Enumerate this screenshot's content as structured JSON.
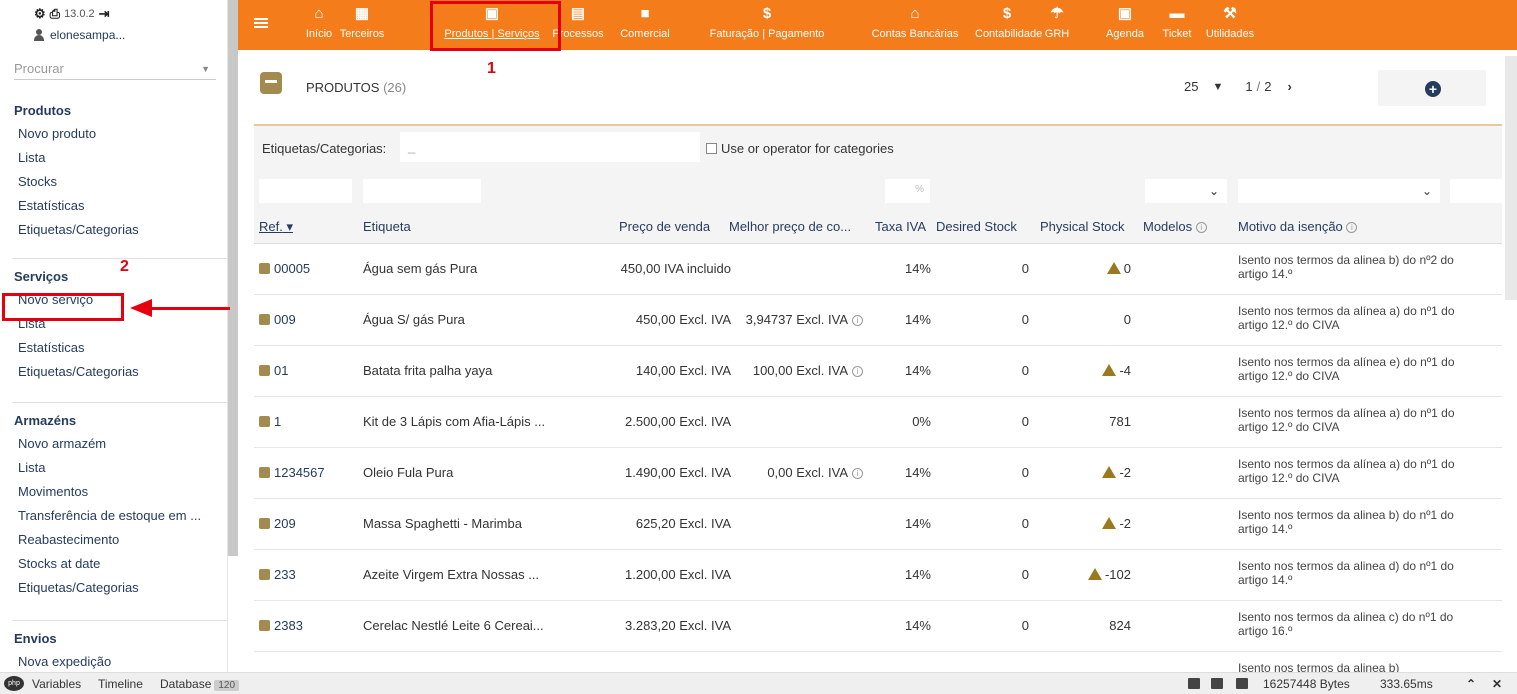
{
  "app": {
    "version": "13.0.2",
    "username": "elonesampa..."
  },
  "sidebar": {
    "search_placeholder": "Procurar",
    "sections": [
      {
        "title": "Produtos",
        "items": [
          "Novo produto",
          "Lista",
          "Stocks",
          "Estatísticas",
          "Etiquetas/Categorias"
        ]
      },
      {
        "title": "Serviços",
        "items": [
          "Novo serviço",
          "Lista",
          "Estatísticas",
          "Etiquetas/Categorias"
        ]
      },
      {
        "title": "Armazéns",
        "items": [
          "Novo armazém",
          "Lista",
          "Movimentos",
          "Transferência de estoque em ...",
          "Reabastecimento",
          "Stocks at date",
          "Etiquetas/Categorias"
        ]
      },
      {
        "title": "Envios",
        "items": [
          "Nova expedição"
        ]
      }
    ]
  },
  "topnav": {
    "items": [
      {
        "label": "Início",
        "icon": "home-icon",
        "glyph": "⌂"
      },
      {
        "label": "Terceiros",
        "icon": "building-icon",
        "glyph": "▦"
      },
      {
        "label": "Produtos | Serviços",
        "icon": "product-icon",
        "glyph": "▣",
        "active": true
      },
      {
        "label": "Processos",
        "icon": "clipboard-icon",
        "glyph": "▤"
      },
      {
        "label": "Comercial",
        "icon": "briefcase-icon",
        "glyph": "■"
      },
      {
        "label": "Faturação | Pagamento",
        "icon": "dollar-icon",
        "glyph": "$"
      },
      {
        "label": "Contas Bancárias",
        "icon": "bank-icon",
        "glyph": "⌂"
      },
      {
        "label": "Contabilidade",
        "icon": "dollar-icon",
        "glyph": "$"
      },
      {
        "label": "GRH",
        "icon": "umbrella-icon",
        "glyph": "☂"
      },
      {
        "label": "Agenda",
        "icon": "calendar-icon",
        "glyph": "▣"
      },
      {
        "label": "Ticket",
        "icon": "ticket-icon",
        "glyph": "▬"
      },
      {
        "label": "Utilidades",
        "icon": "wrench-icon",
        "glyph": "⚒"
      }
    ]
  },
  "annotations": {
    "marker1": "1",
    "marker2": "2"
  },
  "main": {
    "title": "PRODUTOS",
    "count": "(26)",
    "per_page": "25",
    "page_current": "1",
    "page_sep": "/",
    "page_total": "2",
    "next": "›",
    "filter_label": "Etiquetas/Categorias:",
    "filter_value": "_",
    "or_operator_label": "Use or operator for categories",
    "pct_placeholder": "%",
    "columns": [
      "Ref.",
      "Etiqueta",
      "Preço de venda",
      "Melhor preço de co...",
      "Taxa IVA",
      "Desired Stock",
      "Physical Stock",
      "Modelos",
      "Motivo da isenção"
    ],
    "rows": [
      {
        "ref": "00005",
        "label": "Água sem gás Pura",
        "price": "450,00 IVA incluido",
        "best": "",
        "best_info": false,
        "vat": "14%",
        "desired": "0",
        "physical": "0",
        "warn": true,
        "motivo": "Isento nos termos da alinea b) do nº2 do artigo 14.º"
      },
      {
        "ref": "009",
        "label": "Água S/ gás Pura",
        "price": "450,00 Excl. IVA",
        "best": "3,94737 Excl. IVA",
        "best_info": true,
        "vat": "14%",
        "desired": "0",
        "physical": "0",
        "warn": false,
        "motivo": "Isento nos termos da alínea a) do nº1 do artigo 12.º do CIVA"
      },
      {
        "ref": "01",
        "label": "Batata frita palha yaya",
        "price": "140,00 Excl. IVA",
        "best": "100,00 Excl. IVA",
        "best_info": true,
        "vat": "14%",
        "desired": "0",
        "physical": "-4",
        "warn": true,
        "motivo": "Isento nos termos da alínea e) do nº1 do artigo 12.º do CIVA"
      },
      {
        "ref": "1",
        "label": "Kit de 3 Lápis com Afia-Lápis ...",
        "price": "2.500,00 Excl. IVA",
        "best": "",
        "best_info": false,
        "vat": "0%",
        "desired": "0",
        "physical": "781",
        "warn": false,
        "motivo": "Isento nos termos da alínea a) do nº1 do artigo 12.º do CIVA"
      },
      {
        "ref": "1234567",
        "label": "Oleio Fula Pura",
        "price": "1.490,00 Excl. IVA",
        "best": "0,00 Excl. IVA",
        "best_info": true,
        "vat": "14%",
        "desired": "0",
        "physical": "-2",
        "warn": true,
        "motivo": "Isento nos termos da alínea a) do nº1 do artigo 12.º do CIVA"
      },
      {
        "ref": "209",
        "label": "Massa Spaghetti - Marimba",
        "price": "625,20 Excl. IVA",
        "best": "",
        "best_info": false,
        "vat": "14%",
        "desired": "0",
        "physical": "-2",
        "warn": true,
        "motivo": "Isento nos termos da alinea b) do nº1 do artigo 14.º"
      },
      {
        "ref": "233",
        "label": "Azeite Virgem Extra Nossas ...",
        "price": "1.200,00 Excl. IVA",
        "best": "",
        "best_info": false,
        "vat": "14%",
        "desired": "0",
        "physical": "-102",
        "warn": true,
        "motivo": "Isento nos termos da alinea d) do nº1 do artigo 14.º"
      },
      {
        "ref": "2383",
        "label": "Cerelac Nestlé Leite 6 Cereai...",
        "price": "3.283,20 Excl. IVA",
        "best": "",
        "best_info": false,
        "vat": "14%",
        "desired": "0",
        "physical": "824",
        "warn": false,
        "motivo": "Isento nos termos da alinea c) do nº1 do artigo 16.º"
      }
    ],
    "partial_row_motivo": "Isento nos termos da alinea b)"
  },
  "debugbar": {
    "tabs": [
      "Variables",
      "Timeline",
      "Database"
    ],
    "db_count": "120",
    "bytes": "16257448 Bytes",
    "time": "333.65ms"
  }
}
